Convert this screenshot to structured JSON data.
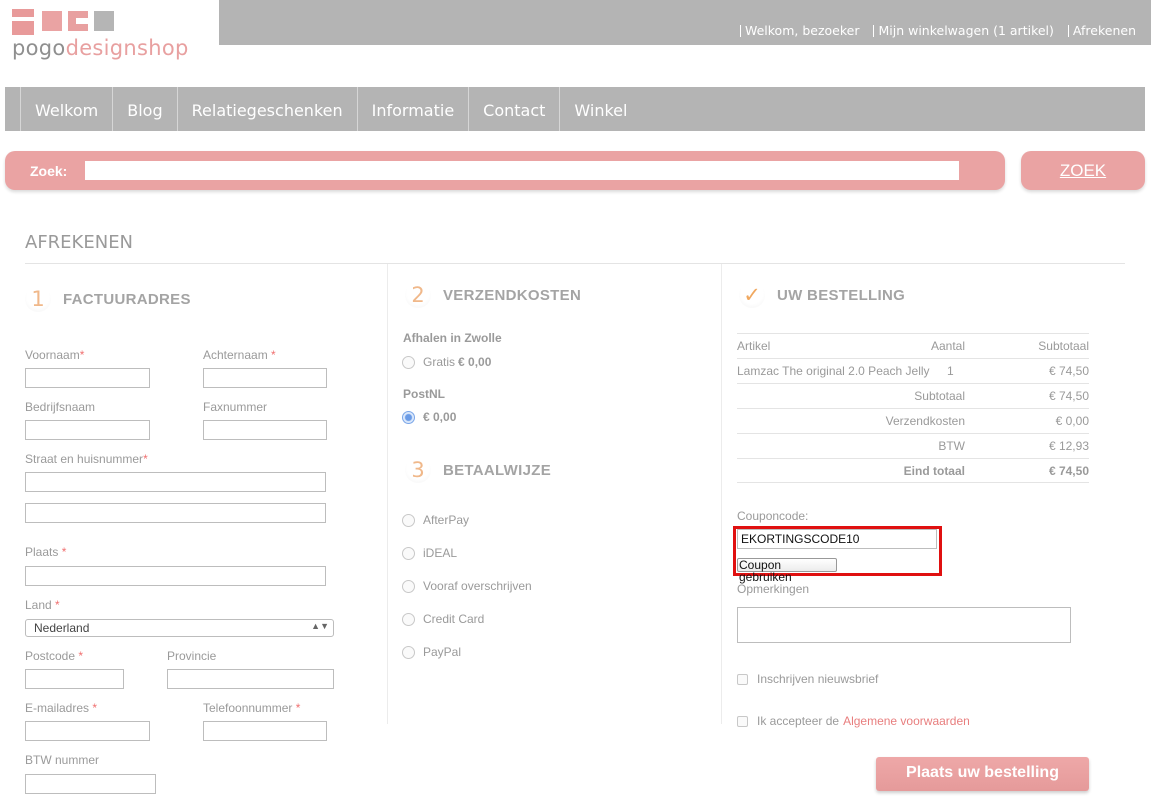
{
  "header": {
    "logo_text_a": "pogo",
    "logo_text_b": "designshop",
    "links": [
      "Welkom, bezoeker",
      "Mijn winkelwagen (1 artikel)",
      "Afrekenen"
    ]
  },
  "nav": [
    "Welkom",
    "Blog",
    "Relatiegeschenken",
    "Informatie",
    "Contact",
    "Winkel"
  ],
  "search": {
    "label": "Zoek:",
    "value": "",
    "button": "ZOEK"
  },
  "page_title": "AFREKENEN",
  "billing": {
    "step": "1",
    "title": "FACTUURADRES",
    "fields": {
      "voornaam": "Voornaam",
      "achternaam": "Achternaam",
      "bedrijfsnaam": "Bedrijfsnaam",
      "faxnummer": "Faxnummer",
      "straat": "Straat en huisnummer",
      "plaats": "Plaats",
      "land": "Land",
      "land_value": "Nederland",
      "postcode": "Postcode",
      "provincie": "Provincie",
      "email": "E-mailadres",
      "telefoon": "Telefoonnummer",
      "btw": "BTW nummer"
    },
    "required_mark": "*"
  },
  "shipping": {
    "step": "2",
    "title": "VERZENDKOSTEN",
    "group1": "Afhalen in Zwolle",
    "option1_label": "Gratis",
    "option1_price": "€ 0,00",
    "group2": "PostNL",
    "option2_price": "€ 0,00"
  },
  "payment": {
    "step": "3",
    "title": "BETAALWIJZE",
    "options": [
      "AfterPay",
      "iDEAL",
      "Vooraf overschrijven",
      "Credit Card",
      "PayPal"
    ]
  },
  "order": {
    "title": "UW BESTELLING",
    "headers": [
      "Artikel",
      "Aantal",
      "Subtotaal"
    ],
    "item": {
      "name": "Lamzac The original 2.0 Peach Jelly",
      "qty": "1",
      "subtotal": "€ 74,50"
    },
    "subtotal_label": "Subtotaal",
    "subtotal_value": "€ 74,50",
    "shipping_label": "Verzendkosten",
    "shipping_value": "€ 0,00",
    "btw_label": "BTW",
    "btw_value": "€ 12,93",
    "total_label": "Eind totaal",
    "total_value": "€ 74,50"
  },
  "coupon": {
    "label": "Couponcode:",
    "value": "EKORTINGSCODE10",
    "button": "Coupon gebruiken"
  },
  "remarks_label": "Opmerkingen",
  "newsletter": "Inschrijven nieuwsbrief",
  "terms": {
    "text": "Ik accepteer de",
    "link": "Algemene voorwaarden"
  },
  "place_order": "Plaats uw bestelling",
  "colors": {
    "accent": "#eaa3a3",
    "bar": "#b4b4b4",
    "highlight": "#e01010"
  }
}
